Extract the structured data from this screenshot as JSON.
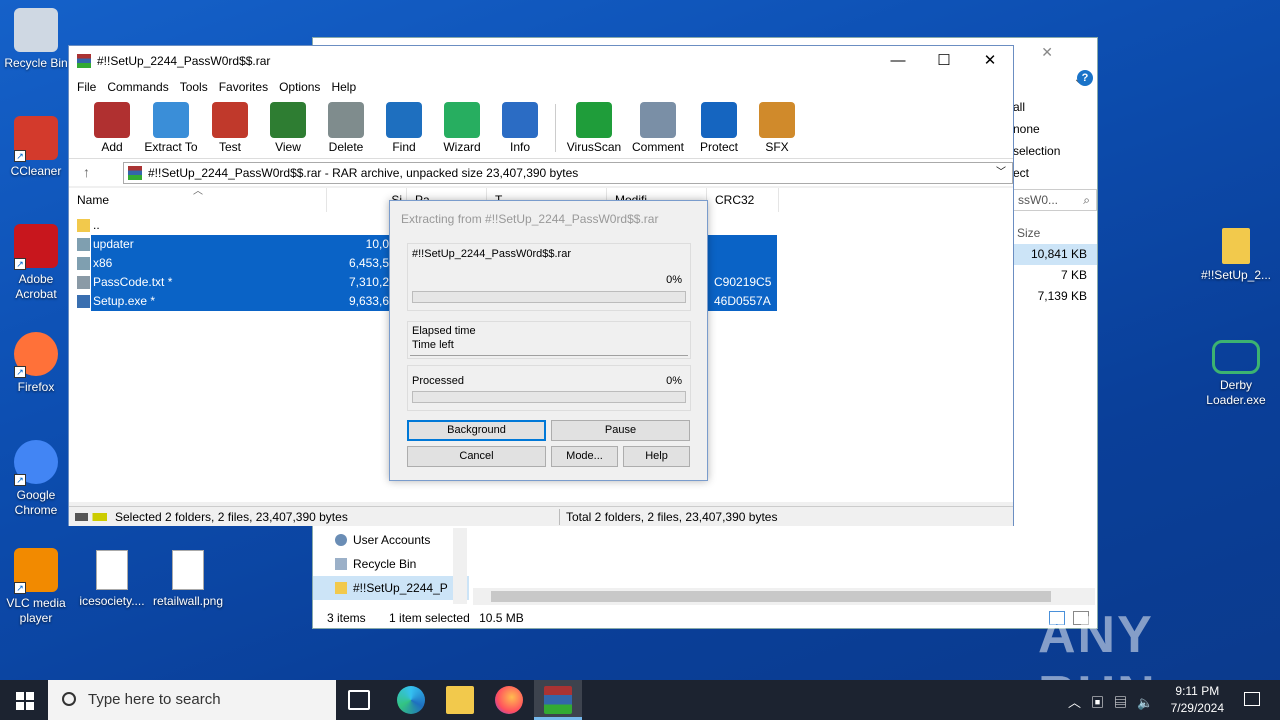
{
  "desktop": {
    "icons_left": [
      {
        "label": "Recycle Bin",
        "color": "#cfd8e3"
      },
      {
        "label": "CCleaner",
        "color": "#d33a2c"
      },
      {
        "label": "Adobe Acrobat",
        "color": "#c8161d"
      },
      {
        "label": "Firefox",
        "color": "#ff7139"
      },
      {
        "label": "Google Chrome",
        "color": "#4285f4"
      },
      {
        "label": "VLC media player",
        "color": "#f28a00"
      }
    ],
    "icons_files": [
      {
        "label": "icesociety...."
      },
      {
        "label": "retailwall.png"
      }
    ],
    "icons_right": [
      {
        "label": "#!!SetUp_2..."
      },
      {
        "label": "Derby Loader.exe"
      }
    ]
  },
  "explorer": {
    "ribbon_items": [
      "all",
      "none",
      "selection",
      "ect"
    ],
    "search_placeholder": "ssW0...",
    "size_header": "Size",
    "sizes": [
      "10,841 KB",
      "7 KB",
      "7,139 KB"
    ],
    "nav_items": [
      {
        "label": "User Accounts",
        "selected": false
      },
      {
        "label": "Recycle Bin",
        "selected": false
      },
      {
        "label": "#!!SetUp_2244_P",
        "selected": true
      }
    ],
    "status": {
      "items": "3 items",
      "selected": "1 item selected",
      "size": "10.5 MB"
    }
  },
  "winrar": {
    "title": "#!!SetUp_2244_PassW0rd$$.rar",
    "menu": [
      "File",
      "Commands",
      "Tools",
      "Favorites",
      "Options",
      "Help"
    ],
    "toolbar": [
      {
        "label": "Add",
        "icon": "add-icon",
        "color": "#b03030"
      },
      {
        "label": "Extract To",
        "icon": "folder-icon",
        "color": "#3a8ed8"
      },
      {
        "label": "Test",
        "icon": "test-icon",
        "color": "#c0392b"
      },
      {
        "label": "View",
        "icon": "book-icon",
        "color": "#2e7d32"
      },
      {
        "label": "Delete",
        "icon": "trash-icon",
        "color": "#7f8c8d"
      },
      {
        "label": "Find",
        "icon": "magnifier-icon",
        "color": "#1e6fbf"
      },
      {
        "label": "Wizard",
        "icon": "wand-icon",
        "color": "#27ae60"
      },
      {
        "label": "Info",
        "icon": "info-icon",
        "color": "#2b6cc4"
      },
      {
        "label": "VirusScan",
        "icon": "bug-icon",
        "color": "#1f9d3a"
      },
      {
        "label": "Comment",
        "icon": "comment-icon",
        "color": "#7a8fa6"
      },
      {
        "label": "Protect",
        "icon": "shield-icon",
        "color": "#1565c0"
      },
      {
        "label": "SFX",
        "icon": "box-icon",
        "color": "#d08a2b"
      }
    ],
    "address": "#!!SetUp_2244_PassW0rd$$.rar - RAR archive, unpacked size 23,407,390 bytes",
    "columns": [
      "Name",
      "Size",
      "Packed",
      "Type",
      "Modified",
      "CRC32"
    ],
    "columns_visible": [
      "Name",
      "Si",
      "Pa",
      "T",
      "Modifi",
      "CRC32"
    ],
    "rows": [
      {
        "name": "..",
        "size": "",
        "crc": "",
        "selected": false,
        "type": "folder"
      },
      {
        "name": "updater",
        "size": "10,0",
        "crc": "",
        "selected": true,
        "type": "folder"
      },
      {
        "name": "x86",
        "size": "6,453,5",
        "crc": "",
        "selected": true,
        "type": "folder"
      },
      {
        "name": "PassCode.txt *",
        "size": "7,310,2",
        "crc": "C90219C5",
        "selected": true,
        "type": "file"
      },
      {
        "name": "Setup.exe *",
        "size": "9,633,6",
        "crc": "46D0557A",
        "selected": true,
        "type": "exe"
      }
    ],
    "status_left": "Selected 2 folders, 2 files, 23,407,390 bytes",
    "status_right": "Total 2 folders, 2 files, 23,407,390 bytes"
  },
  "dialog": {
    "title": "Extracting from #!!SetUp_2244_PassW0rd$$.rar",
    "archive": "#!!SetUp_2244_PassW0rd$$.rar",
    "file_progress": 0,
    "file_pct": "0%",
    "elapsed_label": "Elapsed time",
    "timeleft_label": "Time left",
    "processed_label": "Processed",
    "processed_progress": 0,
    "processed_pct": "0%",
    "buttons": {
      "background": "Background",
      "pause": "Pause",
      "cancel": "Cancel",
      "mode": "Mode...",
      "help": "Help"
    }
  },
  "taskbar": {
    "search_placeholder": "Type here to search",
    "time": "9:11 PM",
    "date": "7/29/2024"
  },
  "watermark": "ANY RUN"
}
